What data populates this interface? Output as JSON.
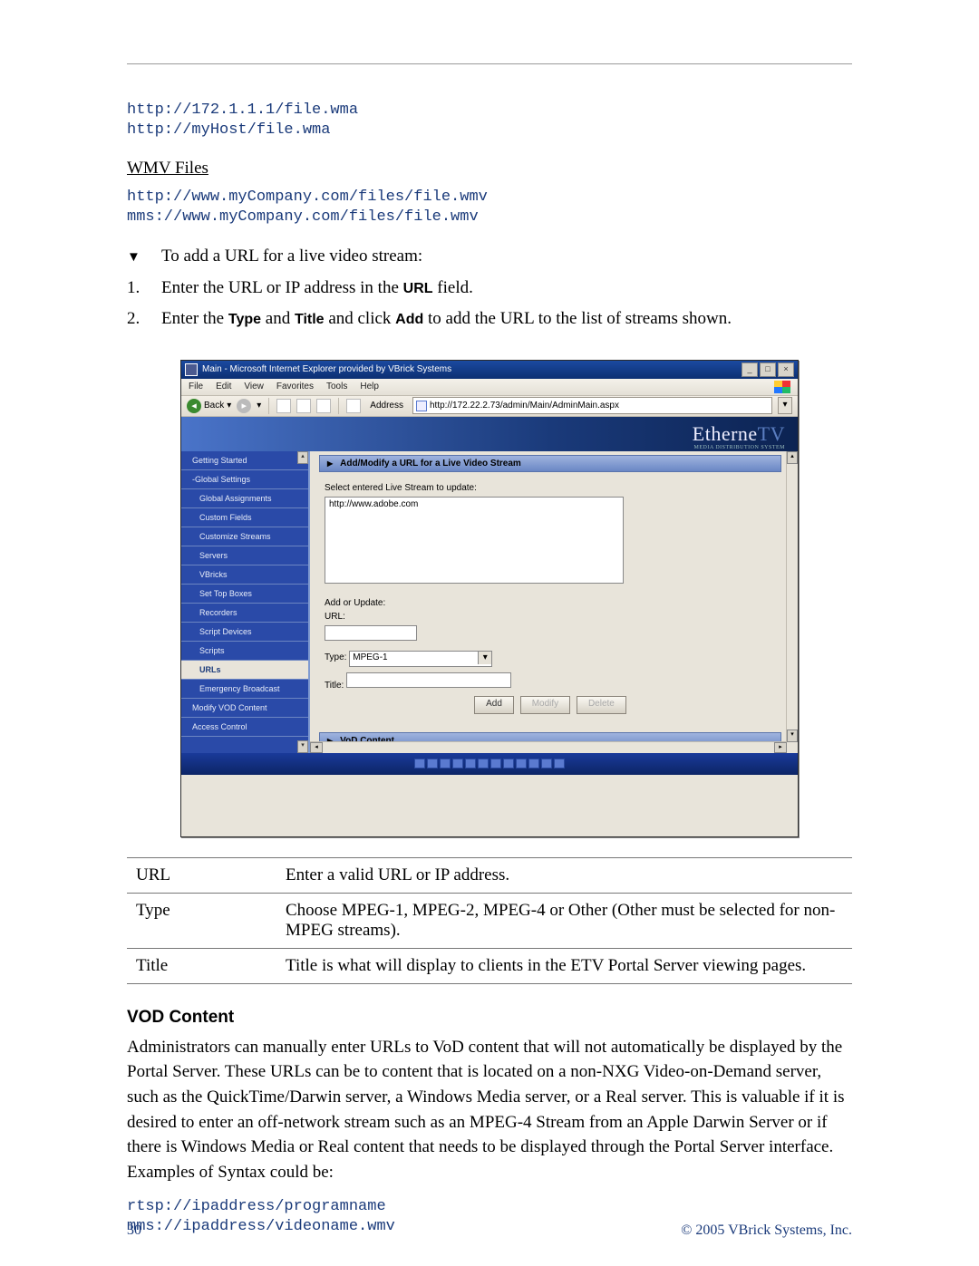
{
  "topCode": {
    "line1": "http://172.1.1.1/file.wma",
    "line2": "http://myHost/file.wma"
  },
  "wmvHeading": "WMV Files",
  "wmvCode": {
    "line1": "http://www.myCompany.com/files/file.wmv",
    "line2": "mms://www.myCompany.com/files/file.wmv"
  },
  "instructions": {
    "intro": "To add a URL for a live video stream:",
    "step1_pre": "Enter the URL or IP address in the ",
    "step1_bold": "URL",
    "step1_post": " field.",
    "step2_pre": "Enter the ",
    "step2_b1": "Type",
    "step2_mid1": " and ",
    "step2_b2": "Title",
    "step2_mid2": " and click ",
    "step2_b3": "Add",
    "step2_post": " to add the URL to the list of streams shown."
  },
  "ie": {
    "title": "Main - Microsoft Internet Explorer provided by VBrick Systems",
    "menus": [
      "File",
      "Edit",
      "View",
      "Favorites",
      "Tools",
      "Help"
    ],
    "back": "Back",
    "addressLabel": "Address",
    "addressValue": "http://172.22.2.73/admin/Main/AdminMain.aspx",
    "bannerTitle": "Etherne",
    "bannerTV": "TV",
    "bannerSub": "MEDIA DISTRIBUTION SYSTEM",
    "sidebar": [
      {
        "label": "Getting Started",
        "lvl": 1
      },
      {
        "label": "-Global Settings",
        "lvl": 1
      },
      {
        "label": "Global Assignments",
        "lvl": 2
      },
      {
        "label": "Custom Fields",
        "lvl": 2
      },
      {
        "label": "Customize Streams",
        "lvl": 2
      },
      {
        "label": "Servers",
        "lvl": 2
      },
      {
        "label": "VBricks",
        "lvl": 2
      },
      {
        "label": "Set Top Boxes",
        "lvl": 2
      },
      {
        "label": "Recorders",
        "lvl": 2
      },
      {
        "label": "Script Devices",
        "lvl": 2
      },
      {
        "label": "Scripts",
        "lvl": 2
      },
      {
        "label": "URLs",
        "lvl": 2,
        "sel": true
      },
      {
        "label": "Emergency Broadcast",
        "lvl": 2
      },
      {
        "label": "Modify VOD Content",
        "lvl": 1
      },
      {
        "label": "Access Control",
        "lvl": 1
      }
    ],
    "sections": {
      "live": {
        "title": "Add/Modify a URL for a Live Video Stream",
        "selectLabel": "Select entered Live Stream to update:",
        "listItem": "http://www.adobe.com",
        "addUpdate": "Add or Update:",
        "urlLabel": "URL:",
        "typeLabel": "Type:",
        "typeValue": "MPEG-1",
        "titleLabel": "Title:",
        "btnAdd": "Add",
        "btnModify": "Modify",
        "btnDelete": "Delete"
      },
      "vod": {
        "title": "VoD Content"
      }
    }
  },
  "defs": [
    {
      "term": "URL",
      "desc": "Enter a valid URL or IP address."
    },
    {
      "term": "Type",
      "desc": "Choose MPEG-1, MPEG-2, MPEG-4 or Other (Other must be selected for non-MPEG streams)."
    },
    {
      "term": "Title",
      "desc": "Title is what will display to clients in the ETV Portal Server viewing pages."
    }
  ],
  "vodHeading": "VOD Content",
  "vodPara": "Administrators can manually enter URLs to VoD content that will not automatically be displayed by the Portal Server. These URLs can be to content that is located on a non-NXG Video-on-Demand server, such as the QuickTime/Darwin server, a Windows Media server, or a Real server. This is valuable if it is desired to enter an off-network stream such as an MPEG-4 Stream from an Apple Darwin Server or if there is Windows Media or Real content that needs to be displayed through the Portal Server interface. Examples of Syntax could be:",
  "vodCode": {
    "line1": "rtsp://ipaddress/programname",
    "line2": "mms://ipaddress/videoname.wmv"
  },
  "footer": {
    "page": "30",
    "copyright": "© 2005 VBrick Systems, Inc."
  }
}
